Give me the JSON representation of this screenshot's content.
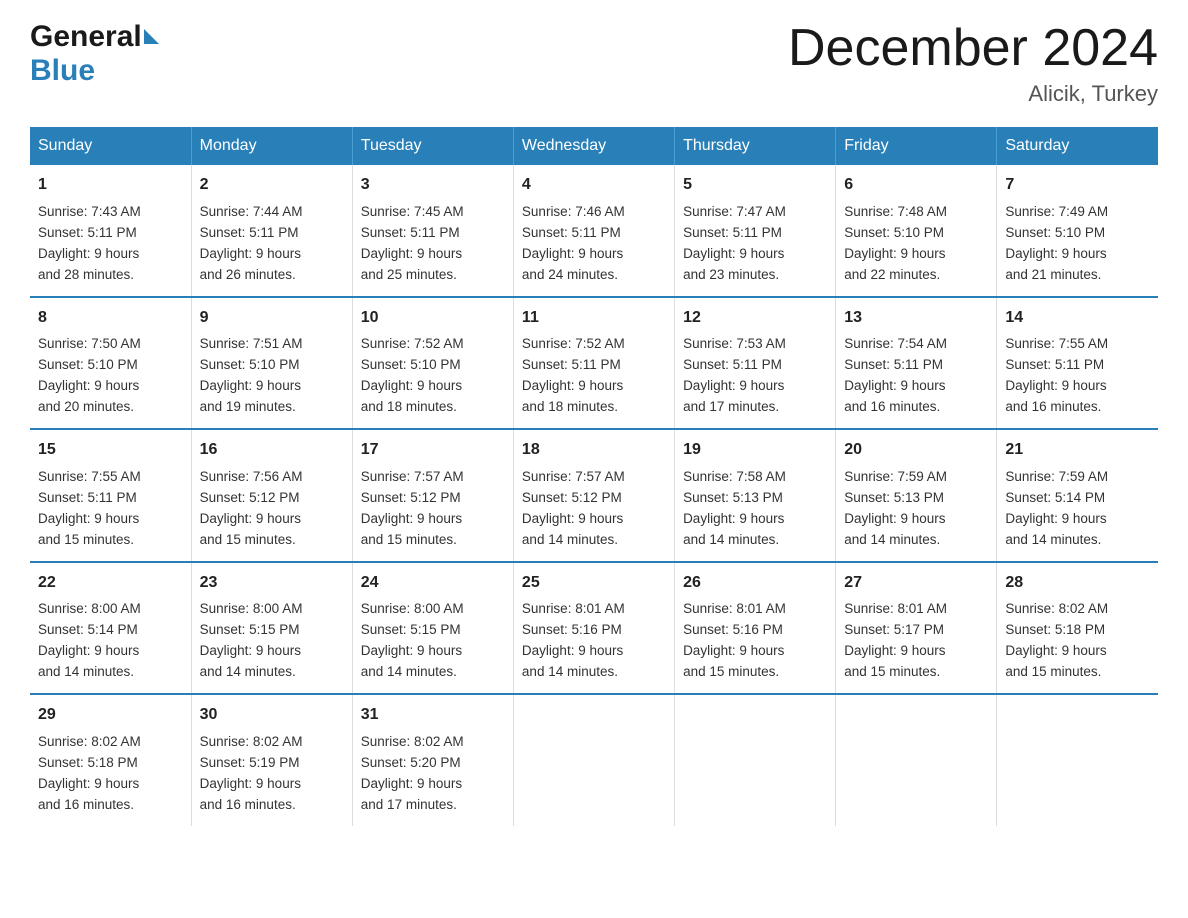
{
  "header": {
    "logo_general": "General",
    "logo_blue": "Blue",
    "title": "December 2024",
    "subtitle": "Alicik, Turkey"
  },
  "days_of_week": [
    "Sunday",
    "Monday",
    "Tuesday",
    "Wednesday",
    "Thursday",
    "Friday",
    "Saturday"
  ],
  "weeks": [
    [
      {
        "day": "1",
        "sunrise": "7:43 AM",
        "sunset": "5:11 PM",
        "daylight": "9 hours and 28 minutes."
      },
      {
        "day": "2",
        "sunrise": "7:44 AM",
        "sunset": "5:11 PM",
        "daylight": "9 hours and 26 minutes."
      },
      {
        "day": "3",
        "sunrise": "7:45 AM",
        "sunset": "5:11 PM",
        "daylight": "9 hours and 25 minutes."
      },
      {
        "day": "4",
        "sunrise": "7:46 AM",
        "sunset": "5:11 PM",
        "daylight": "9 hours and 24 minutes."
      },
      {
        "day": "5",
        "sunrise": "7:47 AM",
        "sunset": "5:11 PM",
        "daylight": "9 hours and 23 minutes."
      },
      {
        "day": "6",
        "sunrise": "7:48 AM",
        "sunset": "5:10 PM",
        "daylight": "9 hours and 22 minutes."
      },
      {
        "day": "7",
        "sunrise": "7:49 AM",
        "sunset": "5:10 PM",
        "daylight": "9 hours and 21 minutes."
      }
    ],
    [
      {
        "day": "8",
        "sunrise": "7:50 AM",
        "sunset": "5:10 PM",
        "daylight": "9 hours and 20 minutes."
      },
      {
        "day": "9",
        "sunrise": "7:51 AM",
        "sunset": "5:10 PM",
        "daylight": "9 hours and 19 minutes."
      },
      {
        "day": "10",
        "sunrise": "7:52 AM",
        "sunset": "5:10 PM",
        "daylight": "9 hours and 18 minutes."
      },
      {
        "day": "11",
        "sunrise": "7:52 AM",
        "sunset": "5:11 PM",
        "daylight": "9 hours and 18 minutes."
      },
      {
        "day": "12",
        "sunrise": "7:53 AM",
        "sunset": "5:11 PM",
        "daylight": "9 hours and 17 minutes."
      },
      {
        "day": "13",
        "sunrise": "7:54 AM",
        "sunset": "5:11 PM",
        "daylight": "9 hours and 16 minutes."
      },
      {
        "day": "14",
        "sunrise": "7:55 AM",
        "sunset": "5:11 PM",
        "daylight": "9 hours and 16 minutes."
      }
    ],
    [
      {
        "day": "15",
        "sunrise": "7:55 AM",
        "sunset": "5:11 PM",
        "daylight": "9 hours and 15 minutes."
      },
      {
        "day": "16",
        "sunrise": "7:56 AM",
        "sunset": "5:12 PM",
        "daylight": "9 hours and 15 minutes."
      },
      {
        "day": "17",
        "sunrise": "7:57 AM",
        "sunset": "5:12 PM",
        "daylight": "9 hours and 15 minutes."
      },
      {
        "day": "18",
        "sunrise": "7:57 AM",
        "sunset": "5:12 PM",
        "daylight": "9 hours and 14 minutes."
      },
      {
        "day": "19",
        "sunrise": "7:58 AM",
        "sunset": "5:13 PM",
        "daylight": "9 hours and 14 minutes."
      },
      {
        "day": "20",
        "sunrise": "7:59 AM",
        "sunset": "5:13 PM",
        "daylight": "9 hours and 14 minutes."
      },
      {
        "day": "21",
        "sunrise": "7:59 AM",
        "sunset": "5:14 PM",
        "daylight": "9 hours and 14 minutes."
      }
    ],
    [
      {
        "day": "22",
        "sunrise": "8:00 AM",
        "sunset": "5:14 PM",
        "daylight": "9 hours and 14 minutes."
      },
      {
        "day": "23",
        "sunrise": "8:00 AM",
        "sunset": "5:15 PM",
        "daylight": "9 hours and 14 minutes."
      },
      {
        "day": "24",
        "sunrise": "8:00 AM",
        "sunset": "5:15 PM",
        "daylight": "9 hours and 14 minutes."
      },
      {
        "day": "25",
        "sunrise": "8:01 AM",
        "sunset": "5:16 PM",
        "daylight": "9 hours and 14 minutes."
      },
      {
        "day": "26",
        "sunrise": "8:01 AM",
        "sunset": "5:16 PM",
        "daylight": "9 hours and 15 minutes."
      },
      {
        "day": "27",
        "sunrise": "8:01 AM",
        "sunset": "5:17 PM",
        "daylight": "9 hours and 15 minutes."
      },
      {
        "day": "28",
        "sunrise": "8:02 AM",
        "sunset": "5:18 PM",
        "daylight": "9 hours and 15 minutes."
      }
    ],
    [
      {
        "day": "29",
        "sunrise": "8:02 AM",
        "sunset": "5:18 PM",
        "daylight": "9 hours and 16 minutes."
      },
      {
        "day": "30",
        "sunrise": "8:02 AM",
        "sunset": "5:19 PM",
        "daylight": "9 hours and 16 minutes."
      },
      {
        "day": "31",
        "sunrise": "8:02 AM",
        "sunset": "5:20 PM",
        "daylight": "9 hours and 17 minutes."
      },
      {
        "day": "",
        "sunrise": "",
        "sunset": "",
        "daylight": ""
      },
      {
        "day": "",
        "sunrise": "",
        "sunset": "",
        "daylight": ""
      },
      {
        "day": "",
        "sunrise": "",
        "sunset": "",
        "daylight": ""
      },
      {
        "day": "",
        "sunrise": "",
        "sunset": "",
        "daylight": ""
      }
    ]
  ],
  "labels": {
    "sunrise": "Sunrise:",
    "sunset": "Sunset:",
    "daylight": "Daylight:"
  },
  "colors": {
    "header_bg": "#2980b9",
    "border": "#2980b9"
  }
}
